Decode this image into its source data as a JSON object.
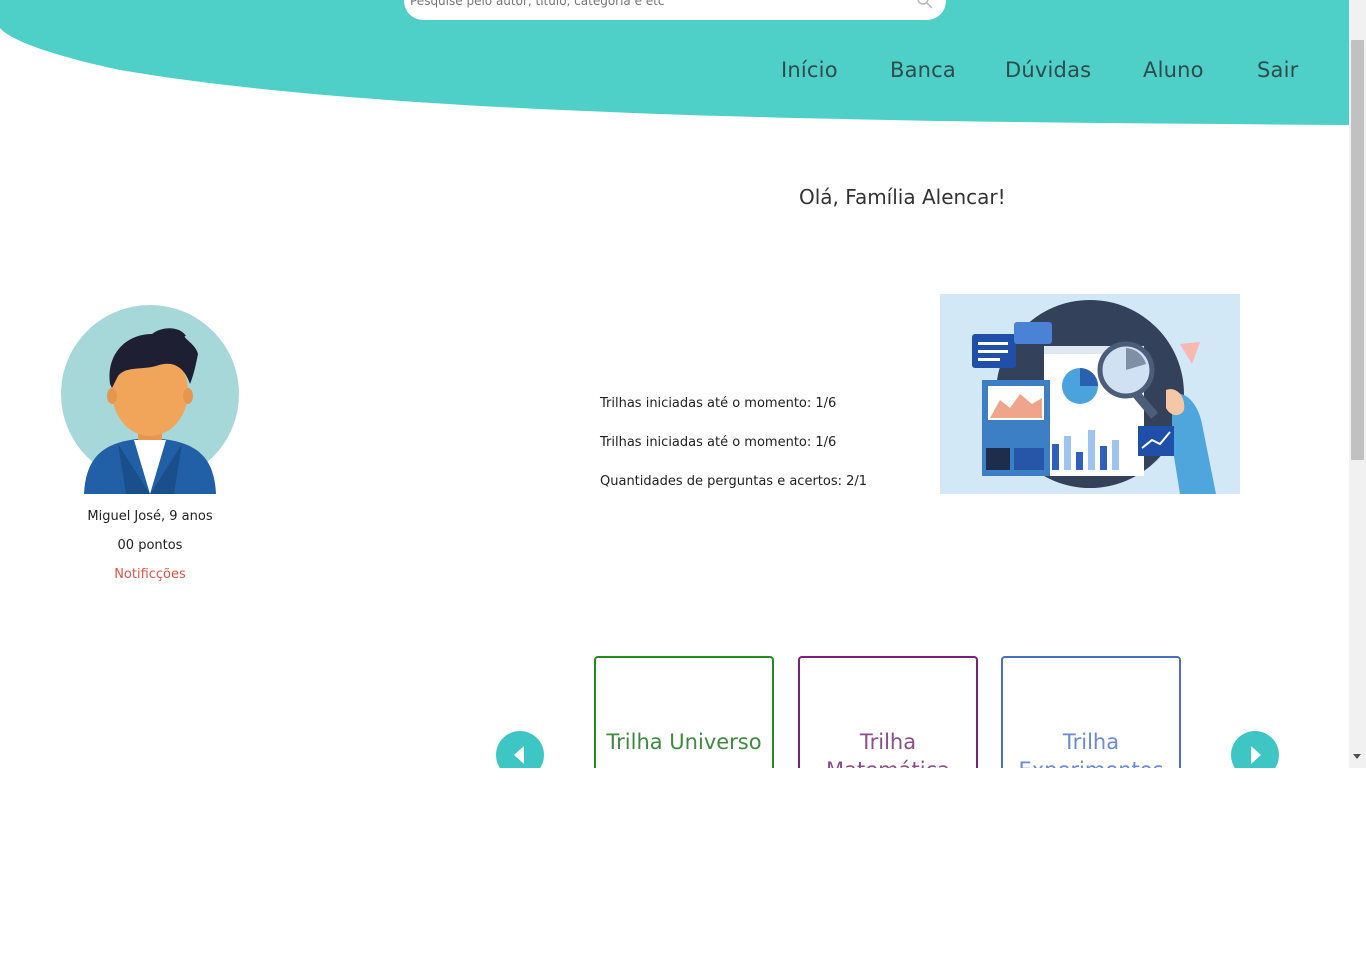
{
  "colors": {
    "header": "#4ecfc7",
    "accent_teal": "#3ec6c4",
    "notification": "#e05548",
    "card_green": "#228b22",
    "card_purple": "#7a1f7a",
    "card_blue": "#4a6fc4"
  },
  "search": {
    "placeholder": "Pesquise pelo autor, título, categoria e etc",
    "icon": "search-icon"
  },
  "nav": {
    "items": [
      {
        "label": "Início"
      },
      {
        "label": "Banca"
      },
      {
        "label": "Dúvidas"
      },
      {
        "label": "Aluno"
      },
      {
        "label": "Sair"
      }
    ]
  },
  "greeting": "Olá, Família Alencar!",
  "profile": {
    "name": "Miguel José, 9 anos",
    "points": "00 pontos",
    "notifications": "Notificções"
  },
  "stats": [
    "Trilhas iniciadas até o momento: 1/6",
    "Trilhas iniciadas até o momento: 1/6",
    "Quantidades de perguntas e acertos: 2/1"
  ],
  "carousel": {
    "prev_icon": "chevron-left-icon",
    "next_icon": "chevron-right-icon",
    "cards": [
      {
        "title": "Trilha Universo"
      },
      {
        "title": "Trilha Matemática"
      },
      {
        "title": "Trilha Experimentos"
      }
    ]
  }
}
